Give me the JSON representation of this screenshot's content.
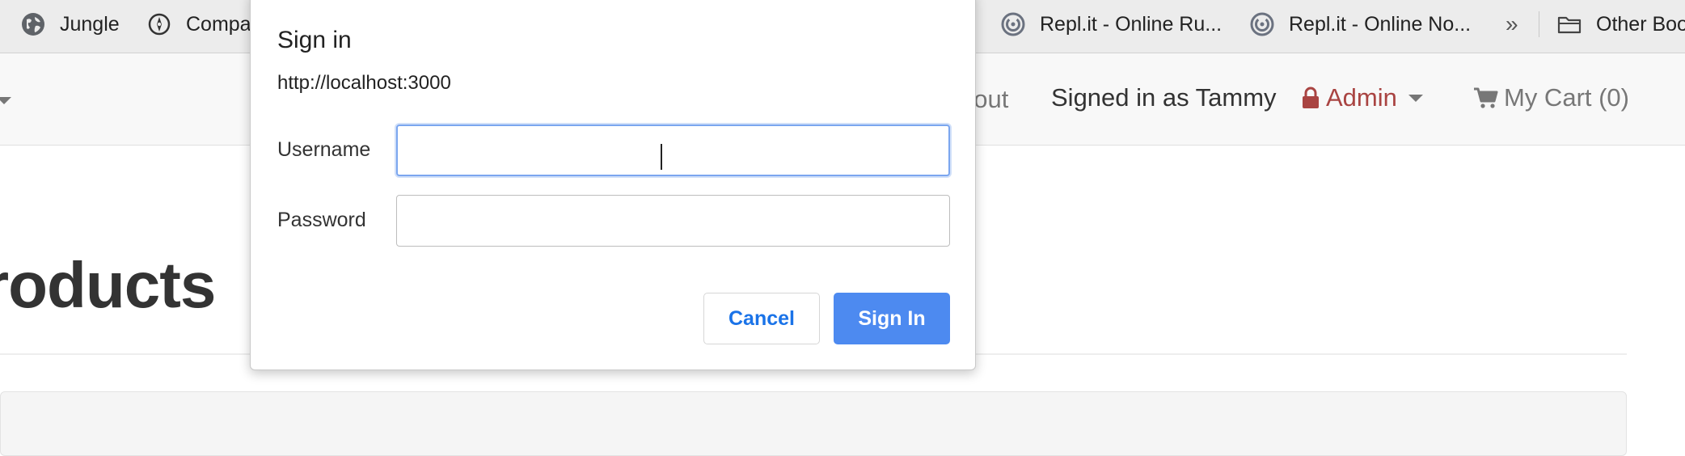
{
  "bookmarks": {
    "items": [
      {
        "label": "Jungle",
        "icon": "globe-icon"
      },
      {
        "label": "Compa",
        "icon": "compass-icon"
      },
      {
        "label": "Repl.it - Online Ru...",
        "icon": "replit-icon"
      },
      {
        "label": "Repl.it - Online No...",
        "icon": "replit-icon"
      }
    ],
    "overflow": "»",
    "other": {
      "label": "Other Boo",
      "icon": "folder-icon"
    }
  },
  "navbar": {
    "logout_partial": "gout",
    "signed_in": "Signed in as Tammy",
    "admin_label": "Admin",
    "admin_color": "#a94442",
    "cart_label": "My Cart (0)"
  },
  "page": {
    "heading_partial": "roducts"
  },
  "dialog": {
    "title": "Sign in",
    "url": "http://localhost:3000",
    "username_label": "Username",
    "username_value": "",
    "password_label": "Password",
    "password_value": "",
    "cancel_label": "Cancel",
    "signin_label": "Sign In",
    "accent_color": "#4d8af0"
  }
}
